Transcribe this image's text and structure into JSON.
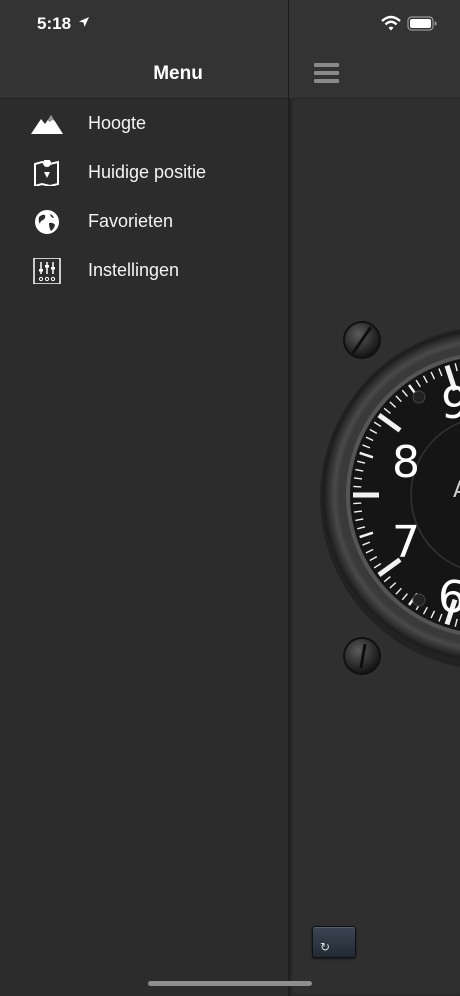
{
  "status_bar": {
    "time": "5:18"
  },
  "menu": {
    "title": "Menu",
    "items": [
      {
        "label": "Hoogte",
        "icon": "mountain-icon"
      },
      {
        "label": "Huidige positie",
        "icon": "map-pin-icon"
      },
      {
        "label": "Favorieten",
        "icon": "globe-icon"
      },
      {
        "label": "Instellingen",
        "icon": "sliders-icon"
      }
    ]
  },
  "altimeter": {
    "dial_numbers": [
      "9",
      "8",
      "7",
      "6"
    ],
    "center_text": "A"
  },
  "refresh_button": {
    "icon": "refresh-icon",
    "glyph": "↻"
  },
  "colors": {
    "background": "#2c2c2c",
    "navbar": "#333333",
    "text": "#ffffff"
  }
}
